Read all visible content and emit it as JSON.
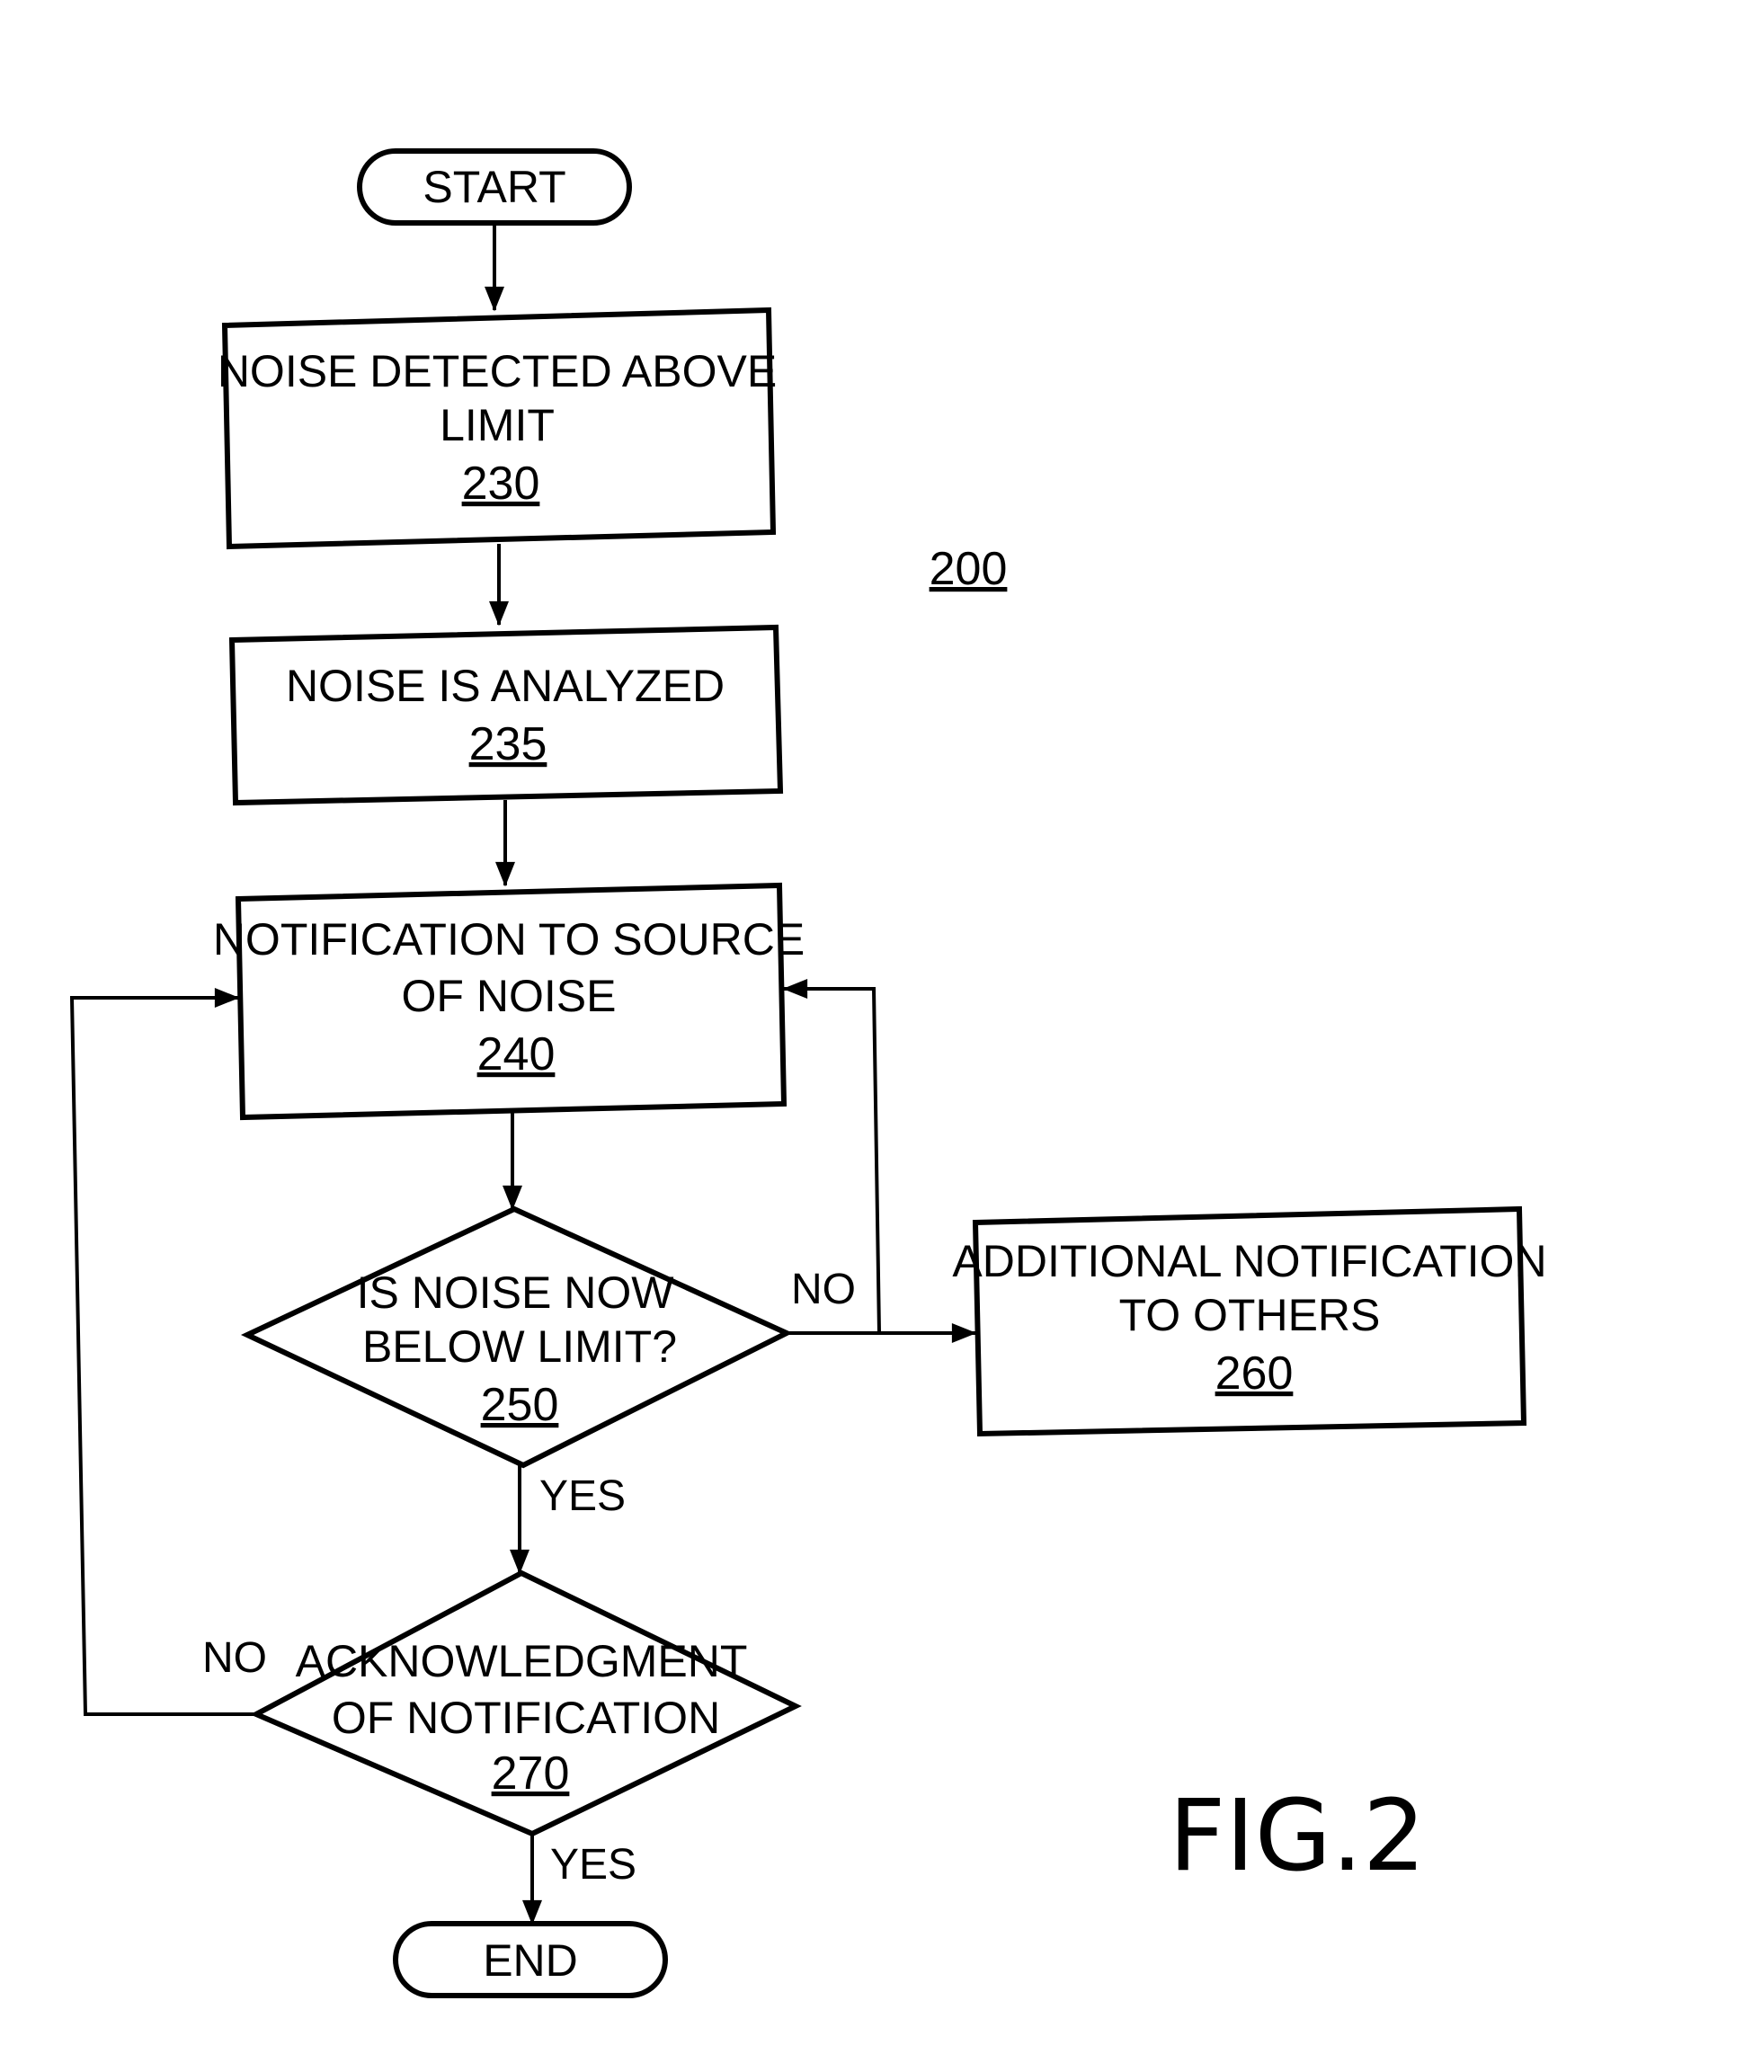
{
  "figure": {
    "label": "FIG.2",
    "reference_number": "200"
  },
  "nodes": {
    "start": {
      "type": "terminal",
      "text": "START"
    },
    "n230": {
      "type": "process",
      "lines": [
        "NOISE  DETECTED  ABOVE",
        "LIMIT"
      ],
      "ref": "230"
    },
    "n235": {
      "type": "process",
      "lines": [
        "NOISE  IS  ANALYZED"
      ],
      "ref": "235"
    },
    "n240": {
      "type": "process",
      "lines": [
        "NOTIFICATION  TO  SOURCE",
        "OF  NOISE"
      ],
      "ref": "240"
    },
    "n250": {
      "type": "decision",
      "lines": [
        "IS  NOISE  NOW",
        "BELOW  LIMIT?"
      ],
      "ref": "250"
    },
    "n260": {
      "type": "process",
      "lines": [
        "ADDITIONAL  NOTIFICATION",
        "TO  OTHERS"
      ],
      "ref": "260"
    },
    "n270": {
      "type": "decision",
      "lines": [
        "ACKNOWLEDGMENT",
        "OF  NOTIFICATION"
      ],
      "ref": "270"
    },
    "end": {
      "type": "terminal",
      "text": "END"
    }
  },
  "edges": [
    {
      "from": "start",
      "to": "n230",
      "label": ""
    },
    {
      "from": "n230",
      "to": "n235",
      "label": ""
    },
    {
      "from": "n235",
      "to": "n240",
      "label": ""
    },
    {
      "from": "n240",
      "to": "n250",
      "label": ""
    },
    {
      "from": "n250",
      "to": "n260",
      "label": "NO"
    },
    {
      "from": "n250",
      "to": "n240",
      "label": "NO"
    },
    {
      "from": "n250",
      "to": "n270",
      "label": "YES"
    },
    {
      "from": "n270",
      "to": "n240",
      "label": "NO"
    },
    {
      "from": "n270",
      "to": "end",
      "label": "YES"
    }
  ],
  "edge_labels": {
    "n250_no": "NO",
    "n250_yes": "YES",
    "n270_no": "NO",
    "n270_yes": "YES"
  }
}
